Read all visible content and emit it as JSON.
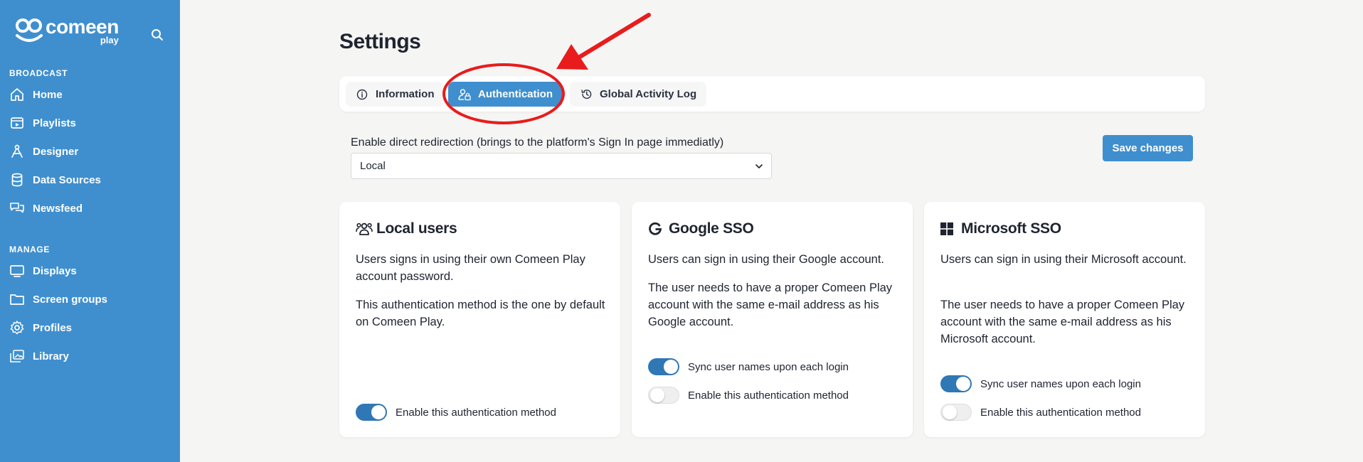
{
  "brand": {
    "name": "comeen",
    "sub": "play"
  },
  "sidebar": {
    "sections": [
      {
        "title": "BROADCAST",
        "items": [
          {
            "label": "Home",
            "icon": "home-icon"
          },
          {
            "label": "Playlists",
            "icon": "playlist-icon"
          },
          {
            "label": "Designer",
            "icon": "designer-icon"
          },
          {
            "label": "Data Sources",
            "icon": "database-icon"
          },
          {
            "label": "Newsfeed",
            "icon": "chat-icon"
          }
        ]
      },
      {
        "title": "MANAGE",
        "items": [
          {
            "label": "Displays",
            "icon": "monitor-icon"
          },
          {
            "label": "Screen groups",
            "icon": "folder-icon"
          },
          {
            "label": "Profiles",
            "icon": "gear-icon"
          },
          {
            "label": "Library",
            "icon": "images-icon"
          }
        ]
      }
    ]
  },
  "page": {
    "title": "Settings"
  },
  "tabs": [
    {
      "label": "Information",
      "icon": "info-icon",
      "active": false
    },
    {
      "label": "Authentication",
      "icon": "user-lock-icon",
      "active": true
    },
    {
      "label": "Global Activity Log",
      "icon": "history-icon",
      "active": false
    }
  ],
  "redirect": {
    "label": "Enable direct redirection (brings to the platform's Sign In page immediatly)",
    "value": "Local"
  },
  "save_button": "Save changes",
  "cards": [
    {
      "title": "Local users",
      "icon": "users-icon",
      "paragraphs": [
        "Users signs in using their own Comeen Play account password.",
        "This authentication method is the one by default on Comeen Play."
      ],
      "toggles": [
        {
          "label": "Enable this authentication method",
          "on": true
        }
      ]
    },
    {
      "title": "Google SSO",
      "icon": "google-icon",
      "paragraphs": [
        "Users can sign in using their Google account.",
        "The user needs to have a proper Comeen Play account with the same e-mail address as his Google account."
      ],
      "toggles": [
        {
          "label": "Sync user names upon each login",
          "on": true
        },
        {
          "label": "Enable this authentication method",
          "on": false
        }
      ]
    },
    {
      "title": "Microsoft SSO",
      "icon": "microsoft-icon",
      "paragraphs": [
        "Users can sign in using their Microsoft account.",
        "The user needs to have a proper Comeen Play account with the same e-mail address as his Microsoft account."
      ],
      "toggles": [
        {
          "label": "Sync user names upon each login",
          "on": true
        },
        {
          "label": "Enable this authentication method",
          "on": false
        }
      ]
    }
  ],
  "colors": {
    "sidebar": "#3f8fcf",
    "accent": "#2f77b5",
    "annotation": "#e81c1c"
  }
}
